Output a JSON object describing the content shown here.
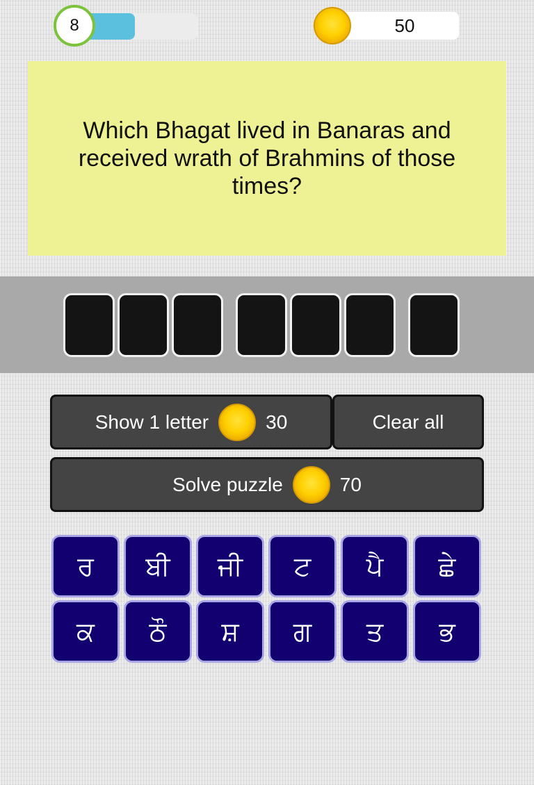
{
  "header": {
    "level": "8",
    "progress_fraction": 0.45,
    "coins": "50"
  },
  "question": {
    "text": "Which Bhagat lived in Banaras and received wrath of Brahmins of those times?"
  },
  "answer": {
    "word_lengths": [
      3,
      3,
      1
    ],
    "slots": [
      "",
      "",
      "",
      "",
      "",
      "",
      ""
    ]
  },
  "actions": {
    "show_letter_label": "Show 1 letter",
    "show_letter_cost": "30",
    "clear_all_label": "Clear all",
    "solve_label": "Solve puzzle",
    "solve_cost": "70"
  },
  "letters": [
    "ਰ",
    "ਬੀ",
    "ਜੀ",
    "ਟ",
    "ਪੈ",
    "ਛੇ",
    "ਕ",
    "ਠੌ",
    "ਸ਼",
    "ਗ",
    "ਤ",
    "ਭ"
  ],
  "colors": {
    "question_bg": "#eef294",
    "key_bg": "#130070",
    "key_border": "#a8a6e6",
    "progress": "#5bc0de",
    "level_ring": "#7cc23c",
    "button_bg": "#444444"
  },
  "icons": {
    "coin": "gold-coin-icon"
  }
}
